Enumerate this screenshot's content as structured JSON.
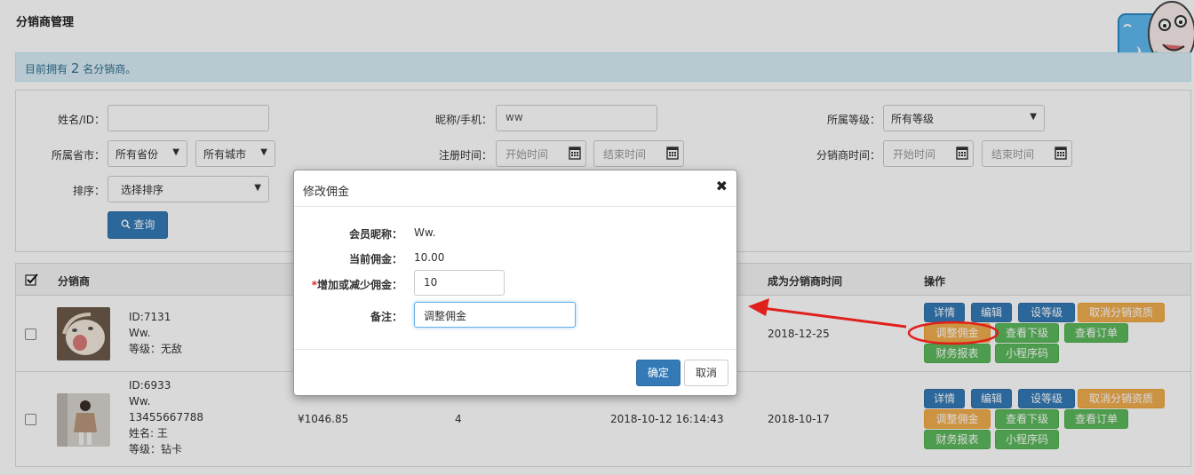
{
  "header": {
    "title": "分销商管理"
  },
  "info": {
    "prefix": "目前拥有",
    "count": "2",
    "suffix": "名分销商。"
  },
  "filters": {
    "name_label": "姓名/ID：",
    "name_value": "",
    "nick_label": "昵称/手机：",
    "nick_value": "ww",
    "level_label": "所属等级：",
    "level_value": "所有等级",
    "province_label": "所属省市：",
    "province_value": "所有省份",
    "city_value": "所有城市",
    "reg_label": "注册时间：",
    "reg_start_placeholder": "开始时间",
    "reg_end_placeholder": "结束时间",
    "dist_time_label": "分销商时间：",
    "dist_start_placeholder": "开始时间",
    "dist_end_placeholder": "结束时间",
    "sort_label": "排序：",
    "sort_value": "选择排序",
    "search_label": "查询"
  },
  "table": {
    "columns": {
      "distributor": "分销商",
      "become_time": "成为分销商时间",
      "ops": "操作"
    },
    "rows": [
      {
        "id": "ID:7131",
        "name": "Ww.",
        "level": "等级：无敌",
        "become_time": "2018-12-25"
      },
      {
        "id": "ID:6933",
        "name": "Ww.",
        "phone": "13455667788",
        "real_name": "姓名: 王",
        "level": "等级：钻卡",
        "amount": "¥1046.85",
        "count": "4",
        "reg_time": "2018-10-12 16:14:43",
        "become_time": "2018-10-17"
      }
    ],
    "actions": {
      "detail": "详情",
      "edit": "编辑",
      "set_level": "设等级",
      "cancel_qual": "取消分销资质",
      "adjust_comm": "调整佣金",
      "view_sub": "查看下级",
      "view_orders": "查看订单",
      "finance": "财务报表",
      "mini_qr": "小程序码"
    }
  },
  "modal": {
    "title": "修改佣金",
    "nick_label": "会员昵称：",
    "nick_value": "Ww.",
    "current_label": "当前佣金：",
    "current_value": "10.00",
    "required_mark": "*",
    "change_label": "增加或减少佣金：",
    "change_value": "10",
    "remark_label": "备注：",
    "remark_value": "调整佣金",
    "ok_label": "确定",
    "cancel_label": "取消"
  },
  "colors": {
    "primary": "#337ab7",
    "warning": "#f0ad4e",
    "success": "#5cb85c",
    "annotation": "#e0201c"
  }
}
